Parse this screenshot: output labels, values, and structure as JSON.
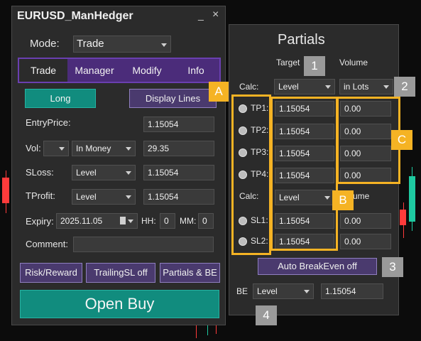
{
  "window": {
    "title": "EURUSD_ManHedger",
    "minimize_label": "_",
    "close_label": "×"
  },
  "mode": {
    "label": "Mode:",
    "value": "Trade"
  },
  "tabs": [
    {
      "label": "Trade",
      "active": true
    },
    {
      "label": "Manager",
      "active": false
    },
    {
      "label": "Modify",
      "active": false
    },
    {
      "label": "Info",
      "active": false
    }
  ],
  "trade": {
    "long_label": "Long",
    "display_lines_label": "Display Lines",
    "entry_label": "EntryPrice:",
    "entry_value": "1.15054",
    "vol_label": "Vol:",
    "vol_mode": "In Money",
    "vol_value": "29.35",
    "sloss_label": "SLoss:",
    "sloss_mode": "Level",
    "sloss_value": "1.15054",
    "tprofit_label": "TProfit:",
    "tprofit_mode": "Level",
    "tprofit_value": "1.15054",
    "expiry_label": "Expiry:",
    "expiry_date": "2025.11.05",
    "hh_label": "HH:",
    "hh_value": "0",
    "mm_label": "MM:",
    "mm_value": "0",
    "comment_label": "Comment:",
    "comment_value": "",
    "risk_reward_label": "Risk/Reward",
    "trailing_label": "TrailingSL off",
    "partials_label": "Partials & BE",
    "open_buy_label": "Open Buy"
  },
  "partials": {
    "title": "Partials",
    "target_header": "Target",
    "volume_header": "Volume",
    "calc_label": "Calc:",
    "calc_target_mode": "Level",
    "calc_volume_mode": "in Lots",
    "tp_rows": [
      {
        "label": "TP1:",
        "target": "1.15054",
        "volume": "0.00"
      },
      {
        "label": "TP2:",
        "target": "1.15054",
        "volume": "0.00"
      },
      {
        "label": "TP3:",
        "target": "1.15054",
        "volume": "0.00"
      },
      {
        "label": "TP4:",
        "target": "1.15054",
        "volume": "0.00"
      }
    ],
    "sl_calc_label": "Calc:",
    "sl_calc_mode": "Level",
    "sl_volume_header": "ume",
    "sl_rows": [
      {
        "label": "SL1:",
        "target": "1.15054",
        "volume": "0.00"
      },
      {
        "label": "SL2:",
        "target": "1.15054",
        "volume": "0.00"
      }
    ],
    "auto_be_label": "Auto BreakEven off",
    "be_label": "BE",
    "be_mode": "Level",
    "be_value": "1.15054"
  },
  "annotations": {
    "A": "A",
    "B": "B",
    "C": "C",
    "n1": "1",
    "n2": "2",
    "n3": "3",
    "n4": "4"
  },
  "colors": {
    "accent_purple": "#4b2c7a",
    "teal": "#118c7e",
    "annotation_yellow": "#f5b324",
    "annotation_grey": "#9a9a9a"
  }
}
